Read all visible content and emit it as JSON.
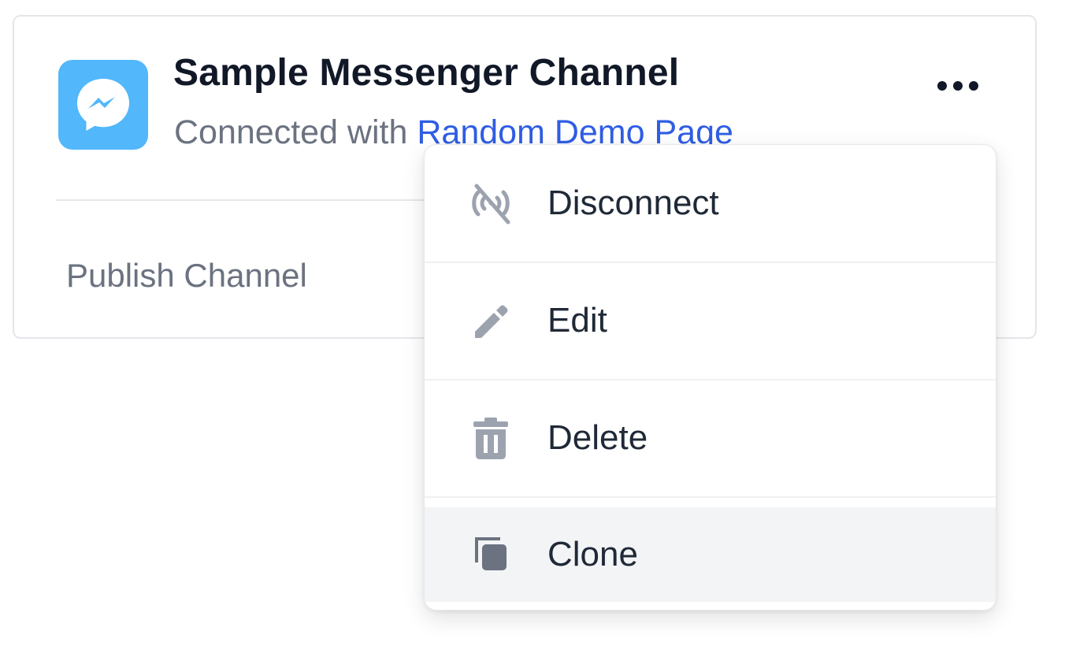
{
  "channel": {
    "title": "Sample Messenger Channel",
    "connected_prefix": "Connected with ",
    "connected_page": "Random Demo Page",
    "publish_label": "Publish Channel"
  },
  "colors": {
    "messenger_icon_bg": "#52b7fb",
    "link": "#2f5de4",
    "muted_text": "#6b7280",
    "title_text": "#111827"
  },
  "menu": {
    "items": [
      {
        "label": "Disconnect",
        "icon": "disconnect-icon"
      },
      {
        "label": "Edit",
        "icon": "pencil-icon"
      },
      {
        "label": "Delete",
        "icon": "trash-icon"
      },
      {
        "label": "Clone",
        "icon": "clone-icon",
        "hovered": true
      }
    ]
  }
}
